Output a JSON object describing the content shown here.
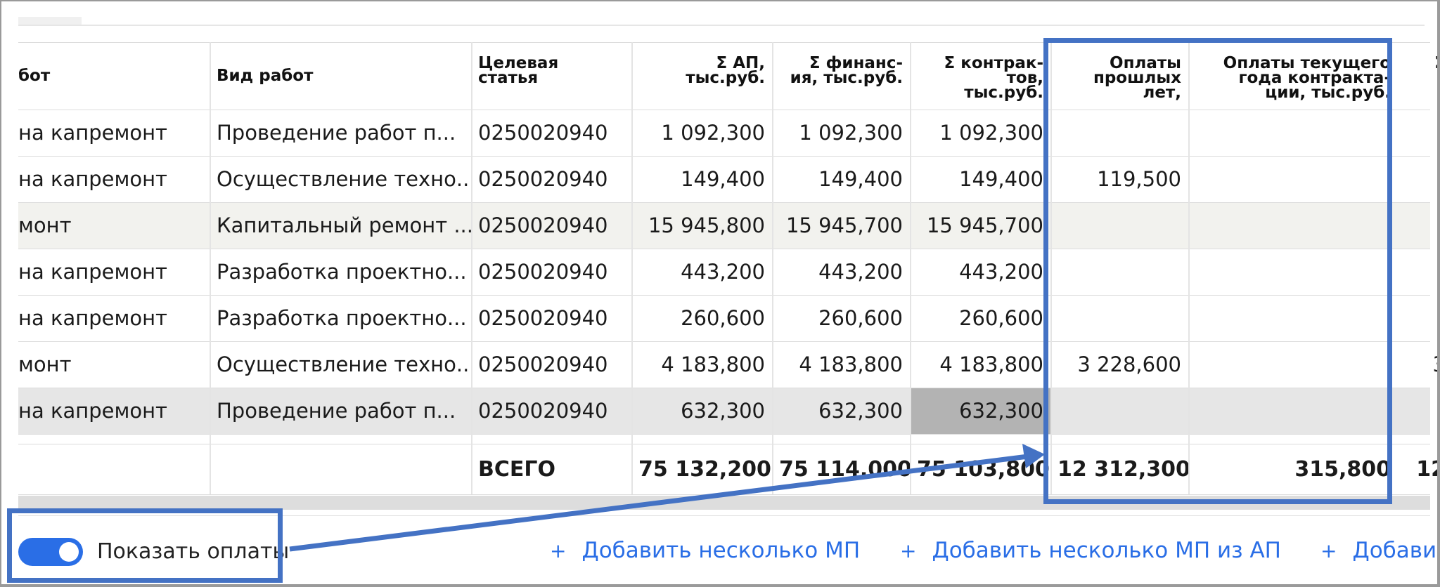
{
  "table": {
    "columns": [
      {
        "key": "work_type_left",
        "label": "бот"
      },
      {
        "key": "work_kind",
        "label": "Вид работ"
      },
      {
        "key": "target_article",
        "label": "Целевая\nстатья"
      },
      {
        "key": "sum_ap",
        "label": "Σ АП,\nтыс.руб."
      },
      {
        "key": "sum_fin",
        "label": "Σ финанс-\nия, тыс.руб."
      },
      {
        "key": "sum_contracts",
        "label": "Σ контрак-\nтов,\nтыс.руб."
      },
      {
        "key": "past_payments",
        "label": "Оплаты\nпрошлых\nлет,"
      },
      {
        "key": "current_payments",
        "label": "Оплаты текущего\nгода контракта-\nции, тыс.руб."
      },
      {
        "key": "next",
        "label": "Σ"
      }
    ],
    "rows": [
      {
        "c0": "на капремонт",
        "c1": "Проведение работ п...",
        "c2": "0250020940",
        "c3": "1 092,300",
        "c4": "1 092,300",
        "c5": "1 092,300",
        "c6": "",
        "c7": "",
        "c8": ""
      },
      {
        "c0": "на капремонт",
        "c1": "Осуществление техно...",
        "c2": "0250020940",
        "c3": "149,400",
        "c4": "149,400",
        "c5": "149,400",
        "c6": "119,500",
        "c7": "",
        "c8": ""
      },
      {
        "c0": "монт",
        "c1": "Капитальный ремонт ...",
        "c2": "0250020940",
        "c3": "15 945,800",
        "c4": "15 945,700",
        "c5": "15 945,700",
        "c6": "",
        "c7": "",
        "c8": ""
      },
      {
        "c0": "на капремонт",
        "c1": "Разработка проектно...",
        "c2": "0250020940",
        "c3": "443,200",
        "c4": "443,200",
        "c5": "443,200",
        "c6": "",
        "c7": "",
        "c8": ""
      },
      {
        "c0": "на капремонт",
        "c1": "Разработка проектно...",
        "c2": "0250020940",
        "c3": "260,600",
        "c4": "260,600",
        "c5": "260,600",
        "c6": "",
        "c7": "",
        "c8": ""
      },
      {
        "c0": "монт",
        "c1": "Осуществление техно...",
        "c2": "0250020940",
        "c3": "4 183,800",
        "c4": "4 183,800",
        "c5": "4 183,800",
        "c6": "3 228,600",
        "c7": "",
        "c8": "3"
      },
      {
        "c0": "на капремонт",
        "c1": "Проведение работ п...",
        "c2": "0250020940",
        "c3": "632,300",
        "c4": "632,300",
        "c5": "632,300",
        "c6": "",
        "c7": "",
        "c8": ""
      }
    ],
    "totals": {
      "label": "ВСЕГО",
      "sum_ap": "75 132,200",
      "sum_fin": "75 114,000",
      "sum_contracts": "75 103,800",
      "past_payments": "12 312,300",
      "current_payments": "315,800",
      "next": "12"
    }
  },
  "footer": {
    "toggle_label": "Показать оплаты",
    "toggle_on": true,
    "add_buttons": [
      "Добавить несколько МП",
      "Добавить несколько МП из АП",
      "Добави"
    ]
  },
  "colors": {
    "accent": "#2a6ee6",
    "annotation": "#4472c4",
    "row_alt": "#f2f2ee",
    "row_selected": "#e6e6e6",
    "cell_highlight": "#b3b3b3"
  }
}
